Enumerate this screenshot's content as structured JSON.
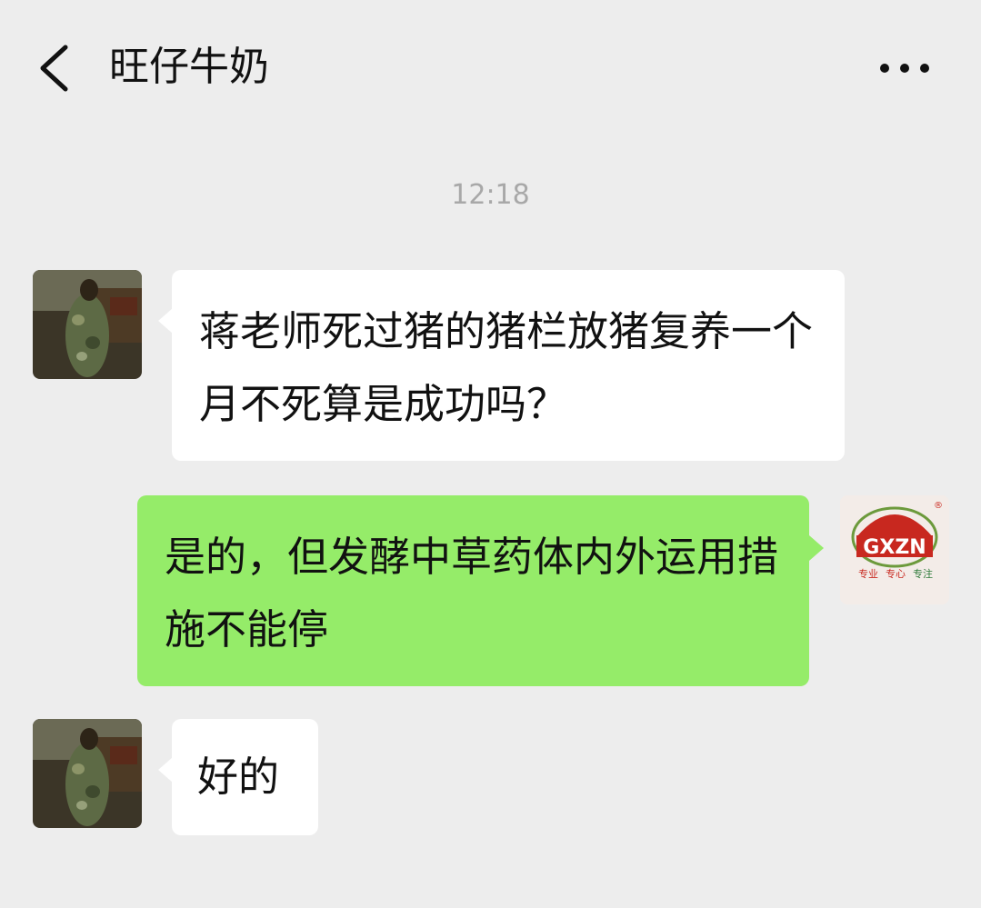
{
  "header": {
    "title": "旺仔牛奶",
    "back_icon": "chevron-left-icon",
    "more_icon": "more-horizontal-icon"
  },
  "timestamp": "12:18",
  "messages": [
    {
      "side": "incoming",
      "text": "蒋老师死过猪的猪栏放猪复养一个月不死算是成功吗？"
    },
    {
      "side": "outgoing",
      "text": "是的，但发酵中草药体内外运用措施不能停"
    },
    {
      "side": "incoming",
      "text": "好的"
    }
  ],
  "logo": {
    "brand": "GXZN",
    "tagline": [
      "专业",
      "专心",
      "专注"
    ],
    "registered": "®"
  },
  "colors": {
    "background": "#ededed",
    "incoming_bubble": "#ffffff",
    "outgoing_bubble": "#95ec69",
    "timestamp_text": "#a8a8a8"
  }
}
